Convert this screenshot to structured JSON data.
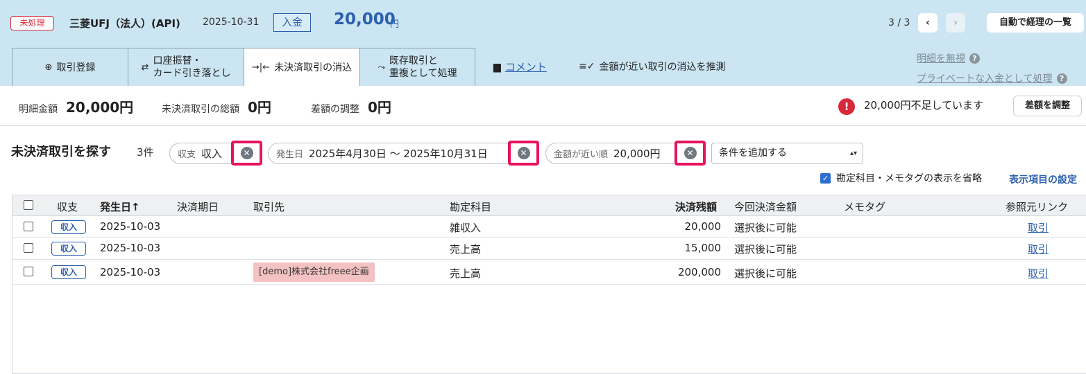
{
  "header": {
    "status": "未処理",
    "bank": "三菱UFJ（法人）(API)",
    "date": "2025-10-31",
    "type": "入金",
    "amount": "20,000",
    "unit": "円",
    "pager": "3 / 3",
    "list_button": "自動で経理の一覧"
  },
  "tabs": [
    {
      "label": "取引登録",
      "icon": "plus-circle-icon"
    },
    {
      "line1": "口座振替・",
      "line2": "カード引き落とし",
      "icon": "transfer-arrows-icon"
    },
    {
      "label": "未決済取引の消込",
      "icon": "reconcile-icon"
    },
    {
      "line1": "既存取引と",
      "line2": "重複として処理",
      "icon": "merge-arrow-icon"
    }
  ],
  "links": {
    "comment": "コメント",
    "guess": "金額が近い取引の消込を推測",
    "ignore": "明細を無視",
    "private": "プライベートな入金として処理"
  },
  "summary": {
    "detail_label": "明細金額",
    "detail_value": "20,000円",
    "total_label": "未決済取引の総額",
    "total_value": "0円",
    "diff_label": "差額の調整",
    "diff_value": "0円",
    "warning": "20,000円不足しています",
    "adjust_button": "差額を調整"
  },
  "search": {
    "title": "未決済取引を探す",
    "count": "3件",
    "filters": [
      {
        "label": "収支",
        "value": "収入"
      },
      {
        "label": "発生日",
        "value": "2025年4月30日 〜 2025年10月31日"
      },
      {
        "label": "金額が近い順",
        "value": "20,000円"
      }
    ],
    "add_condition": "条件を追加する",
    "omit_option": "勘定科目・メモタグの表示を省略",
    "settings_link": "表示項目の設定"
  },
  "table": {
    "headers": [
      "収支",
      "発生日",
      "決済期日",
      "取引先",
      "勘定科目",
      "決済残額",
      "今回決済金額",
      "メモタグ",
      "参照元リンク"
    ],
    "sort_arrow": "↑",
    "rows": [
      {
        "type": "収入",
        "date": "2025-10-03",
        "due": "",
        "partner": "",
        "account": "雑収入",
        "balance": "20,000",
        "payment": "選択後に可能",
        "memo": "",
        "ref": "取引"
      },
      {
        "type": "収入",
        "date": "2025-10-03",
        "due": "",
        "partner": "",
        "account": "売上高",
        "balance": "15,000",
        "payment": "選択後に可能",
        "memo": "",
        "ref": "取引"
      },
      {
        "type": "収入",
        "date": "2025-10-03",
        "due": "",
        "partner": "[demo]株式会社freee企画",
        "account": "売上高",
        "balance": "200,000",
        "payment": "選択後に可能",
        "memo": "",
        "ref": "取引"
      }
    ]
  }
}
